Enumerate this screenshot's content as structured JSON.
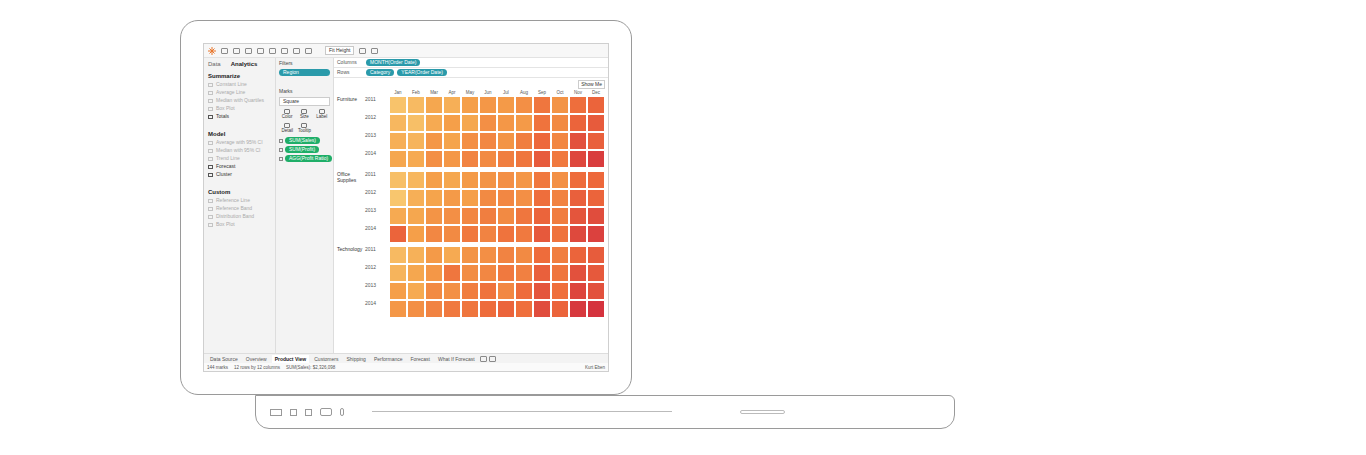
{
  "toolbar": {
    "fit": "Fit Height",
    "show_me": "Show Me"
  },
  "side_tabs": [
    {
      "label": "Data",
      "selected": false
    },
    {
      "label": "Analytics",
      "selected": true
    }
  ],
  "analytics": [
    {
      "heading": "Summarize",
      "items": [
        {
          "label": "Constant Line",
          "enabled": false
        },
        {
          "label": "Average Line",
          "enabled": false
        },
        {
          "label": "Median with Quartiles",
          "enabled": false
        },
        {
          "label": "Box Plot",
          "enabled": false
        },
        {
          "label": "Totals",
          "enabled": true
        }
      ]
    },
    {
      "heading": "Model",
      "items": [
        {
          "label": "Average with 95% CI",
          "enabled": false
        },
        {
          "label": "Median with 95% CI",
          "enabled": false
        },
        {
          "label": "Trend Line",
          "enabled": false
        },
        {
          "label": "Forecast",
          "enabled": true
        },
        {
          "label": "Cluster",
          "enabled": true
        }
      ]
    },
    {
      "heading": "Custom",
      "items": [
        {
          "label": "Reference Line",
          "enabled": false
        },
        {
          "label": "Reference Band",
          "enabled": false
        },
        {
          "label": "Distribution Band",
          "enabled": false
        },
        {
          "label": "Box Plot",
          "enabled": false
        }
      ]
    }
  ],
  "filters": {
    "title": "Filters",
    "pills": [
      "Region"
    ]
  },
  "marks": {
    "title": "Marks",
    "type": "Square",
    "buttons": [
      "Color",
      "Size",
      "Label",
      "Detail",
      "Tooltip"
    ],
    "pills": [
      "SUM(Sales)",
      "SUM(Profit)",
      "AGG(Profit Ratio)"
    ]
  },
  "shelves": [
    {
      "label": "Columns",
      "pills": [
        "MONTH(Order Date)"
      ]
    },
    {
      "label": "Rows",
      "pills": [
        "Category",
        "YEAR(Order Date)"
      ]
    }
  ],
  "months": [
    "Jan",
    "Feb",
    "Mar",
    "Apr",
    "May",
    "Jun",
    "Jul",
    "Aug",
    "Sep",
    "Oct",
    "Nov",
    "Dec"
  ],
  "heatmap": [
    {
      "category": "Furniture",
      "years": [
        {
          "year": "2011",
          "values": [
            12,
            18,
            30,
            25,
            35,
            40,
            38,
            45,
            60,
            42,
            65,
            70
          ]
        },
        {
          "year": "2012",
          "values": [
            20,
            15,
            28,
            35,
            30,
            45,
            40,
            38,
            62,
            48,
            70,
            75
          ]
        },
        {
          "year": "2013",
          "values": [
            25,
            22,
            40,
            32,
            45,
            50,
            42,
            55,
            68,
            50,
            80,
            72
          ]
        },
        {
          "year": "2014",
          "values": [
            30,
            28,
            45,
            40,
            52,
            48,
            55,
            60,
            75,
            58,
            85,
            90
          ]
        }
      ]
    },
    {
      "category": "Office Supplies",
      "years": [
        {
          "year": "2011",
          "values": [
            15,
            20,
            35,
            30,
            38,
            42,
            45,
            40,
            58,
            44,
            66,
            68
          ]
        },
        {
          "year": "2012",
          "values": [
            10,
            25,
            32,
            38,
            35,
            48,
            50,
            45,
            65,
            52,
            72,
            70
          ]
        },
        {
          "year": "2013",
          "values": [
            28,
            30,
            42,
            45,
            50,
            55,
            48,
            60,
            70,
            56,
            78,
            82
          ]
        },
        {
          "year": "2014",
          "values": [
            70,
            35,
            50,
            48,
            58,
            52,
            62,
            58,
            76,
            62,
            84,
            88
          ]
        }
      ]
    },
    {
      "category": "Technology",
      "years": [
        {
          "year": "2011",
          "values": [
            18,
            24,
            38,
            28,
            42,
            45,
            52,
            48,
            66,
            55,
            70,
            74
          ]
        },
        {
          "year": "2012",
          "values": [
            22,
            30,
            40,
            60,
            46,
            50,
            58,
            54,
            72,
            60,
            80,
            76
          ]
        },
        {
          "year": "2013",
          "values": [
            35,
            28,
            48,
            44,
            55,
            62,
            50,
            66,
            78,
            64,
            86,
            80
          ]
        },
        {
          "year": "2014",
          "values": [
            40,
            45,
            52,
            58,
            60,
            66,
            70,
            64,
            82,
            70,
            92,
            95
          ]
        }
      ]
    }
  ],
  "sheet_tabs": [
    {
      "label": "Data Source",
      "selected": false
    },
    {
      "label": "Overview",
      "selected": false
    },
    {
      "label": "Product View",
      "selected": true
    },
    {
      "label": "Customers",
      "selected": false
    },
    {
      "label": "Shipping",
      "selected": false
    },
    {
      "label": "Performance",
      "selected": false
    },
    {
      "label": "Forecast",
      "selected": false
    },
    {
      "label": "What If Forecast",
      "selected": false
    }
  ],
  "status": [
    "144 marks",
    "12 rows by 12 columns",
    "SUM(Sales): $2,326,098"
  ],
  "user": "Kurt Eben"
}
